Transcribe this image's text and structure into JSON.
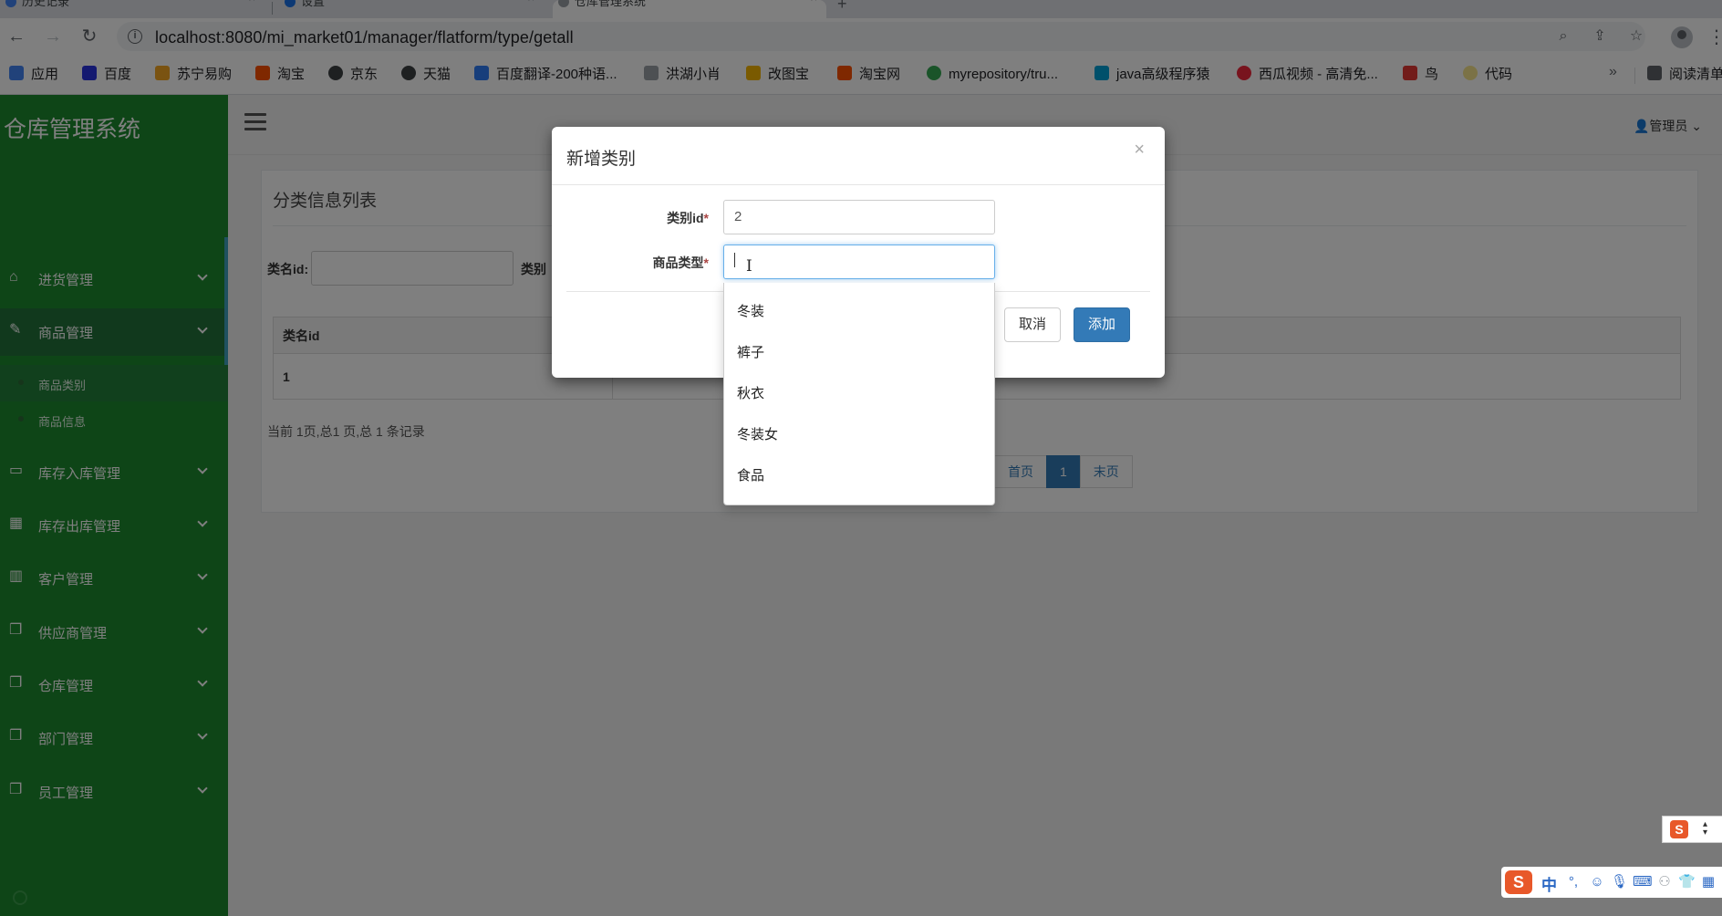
{
  "browser": {
    "tabs": [
      {
        "title": "历史记录"
      },
      {
        "title": "设置"
      },
      {
        "title": "仓库管理系统"
      }
    ],
    "url": "localhost:8080/mi_market01/manager/flatform/type/getall",
    "bookmarks": [
      {
        "label": "应用",
        "color": "#4285f4"
      },
      {
        "label": "百度",
        "color": "#2932e1"
      },
      {
        "label": "苏宁易购",
        "color": "#f5a623"
      },
      {
        "label": "淘宝",
        "color": "#ff5000"
      },
      {
        "label": "京东",
        "color": "#3c4043"
      },
      {
        "label": "天猫",
        "color": "#3c4043"
      },
      {
        "label": "百度翻译-200种语...",
        "color": "#2f7cf6"
      },
      {
        "label": "洪湖小肖",
        "color": "#9aa0a6"
      },
      {
        "label": "改图宝",
        "color": "#f4b400"
      },
      {
        "label": "淘宝网",
        "color": "#ff5000"
      },
      {
        "label": "myrepository/tru...",
        "color": "#34a853"
      },
      {
        "label": "java高级程序猿",
        "color": "#00a1d6"
      },
      {
        "label": "西瓜视频 - 高清免...",
        "color": "#f0283c"
      },
      {
        "label": "鸟",
        "color": "#e53935"
      },
      {
        "label": "代码",
        "color": "#f6e58d"
      },
      {
        "label": "阅读清单",
        "color": "#5f6368"
      }
    ],
    "more_bookmarks": "»"
  },
  "app": {
    "brand": "仓库管理系统",
    "admin_label": "管理员",
    "menu": [
      {
        "label": "进货管理",
        "icon": "home-icon"
      },
      {
        "label": "商品管理",
        "icon": "edit-icon"
      },
      {
        "label": "库存入库管理",
        "icon": "monitor-icon"
      },
      {
        "label": "库存出库管理",
        "icon": "grid-icon"
      },
      {
        "label": "客户管理",
        "icon": "bar-chart-icon"
      },
      {
        "label": "供应商管理",
        "icon": "copy-icon"
      },
      {
        "label": "仓库管理",
        "icon": "copy-icon"
      },
      {
        "label": "部门管理",
        "icon": "copy-icon"
      },
      {
        "label": "员工管理",
        "icon": "copy-icon"
      }
    ],
    "submenu": [
      {
        "label": "商品类别"
      },
      {
        "label": "商品信息"
      }
    ]
  },
  "panel": {
    "title": "分类信息列表",
    "filter_label_1": "类名id:",
    "filter_label_2": "类别",
    "table": {
      "headers": [
        "类名id"
      ],
      "rows": [
        [
          "1"
        ]
      ]
    },
    "page_info": "当前 1页,总1 页,总 1 条记录",
    "pager": {
      "first": "首页",
      "current": "1",
      "last": "末页"
    }
  },
  "modal": {
    "title": "新增类别",
    "close": "×",
    "field_id_label": "类别id",
    "field_id_value": "2",
    "field_type_label": "商品类型",
    "required_mark": "*",
    "cancel_label": "取消",
    "add_label": "添加"
  },
  "dropdown": {
    "options": [
      "冬装",
      "裤子",
      "秋衣",
      "冬装女",
      "食品"
    ]
  },
  "ime": {
    "lang": "中",
    "punct": "°,"
  }
}
